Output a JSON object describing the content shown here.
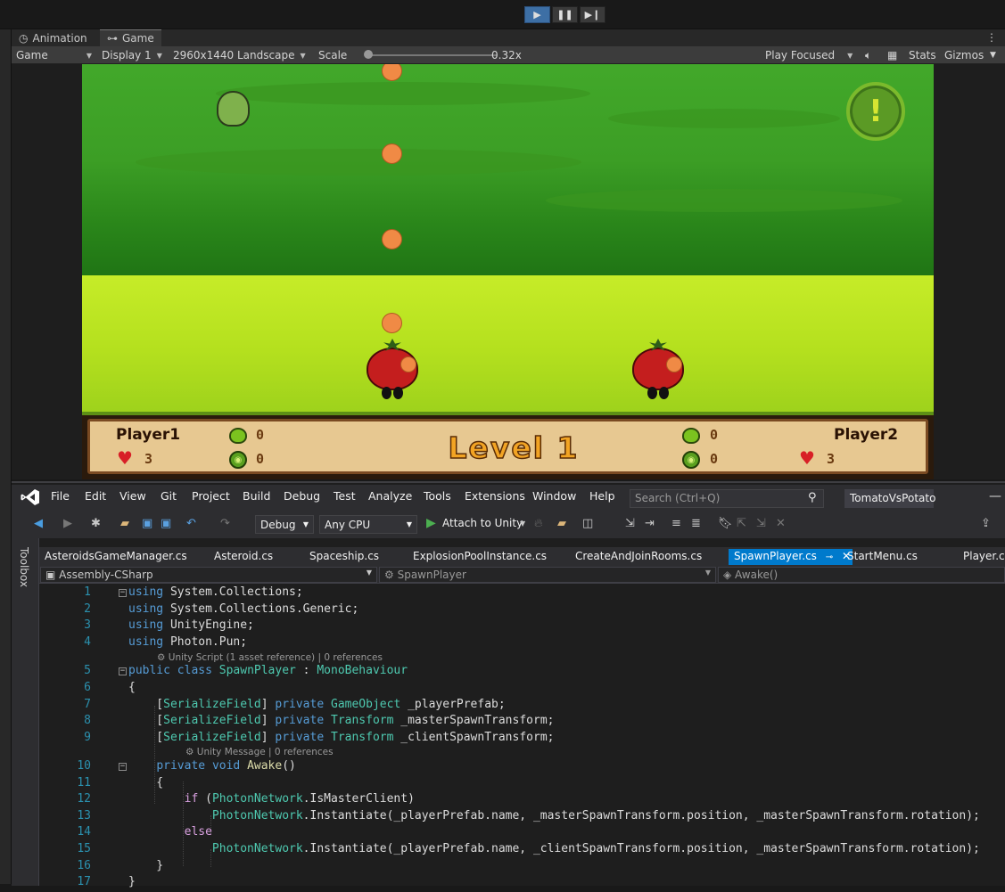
{
  "unity": {
    "tabs": [
      {
        "label": "Animation",
        "icon": "clock-icon"
      },
      {
        "label": "Game",
        "icon": "gamepad-icon"
      }
    ],
    "toolbar": {
      "view": "Game",
      "display": "Display 1",
      "resolution": "2960x1440 Landscape",
      "scale_label": "Scale",
      "scale_value": "0.32x",
      "scale_level": 0.0,
      "play_mode": "Play Focused",
      "stats": "Stats",
      "gizmos": "Gizmos"
    },
    "game": {
      "player1": "Player1",
      "player2": "Player2",
      "level": "Level  1",
      "p1_potions": "0",
      "p1_coins": "0",
      "p1_lives": "3",
      "p2_potions": "0",
      "p2_coins": "0",
      "p2_lives": "3"
    }
  },
  "vs": {
    "menu": [
      "File",
      "Edit",
      "View",
      "Git",
      "Project",
      "Build",
      "Debug",
      "Test",
      "Analyze",
      "Tools",
      "Extensions",
      "Window",
      "Help"
    ],
    "search_placeholder": "Search (Ctrl+Q)",
    "project": "TomatoVsPotato",
    "config": "Debug",
    "platform": "Any CPU",
    "attach": "Attach to Unity",
    "toolbox": "Toolbox",
    "file_tabs": [
      "AsteroidsGameManager.cs",
      "Asteroid.cs",
      "Spaceship.cs",
      "ExplosionPoolInstance.cs",
      "CreateAndJoinRooms.cs",
      "SpawnPlayer.cs",
      "StartMenu.cs",
      "Player.cs"
    ],
    "active_tab": "SpawnPlayer.cs",
    "nav": {
      "project": "Assembly-CSharp",
      "class": "SpawnPlayer",
      "member": "Awake()"
    },
    "lens1": "Unity Script (1 asset reference) | 0 references",
    "lens2": "Unity Message | 0 references",
    "lines": [
      "1",
      "2",
      "3",
      "4",
      "5",
      "6",
      "7",
      "8",
      "9",
      "10",
      "11",
      "12",
      "13",
      "14",
      "15",
      "16",
      "17"
    ]
  },
  "colors": {
    "accent": "#007acc",
    "keyword": "#569cd6",
    "type": "#4ec9b0",
    "control": "#d8a0df",
    "linenum": "#2b91af"
  }
}
